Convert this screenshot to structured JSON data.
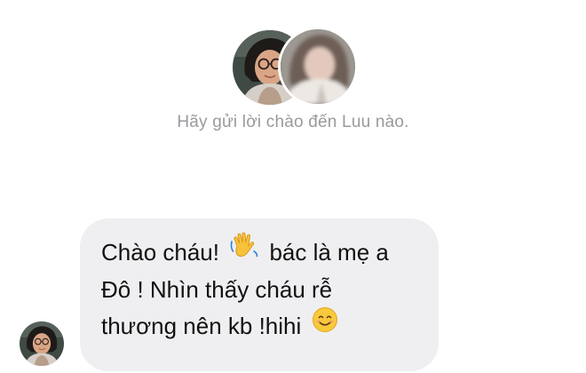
{
  "header": {
    "avatars": [
      {
        "icon": "profile-photo-woman-glasses"
      },
      {
        "icon": "profile-photo-blurred-user"
      }
    ],
    "greeting": "Hãy gửi lời chào đến Luu nào."
  },
  "message": {
    "sender_avatar_icon": "profile-photo-woman-glasses",
    "lines": [
      {
        "before": "Chào cháu! ",
        "emoji": "waving-hand-emoji",
        "after": " bác là mẹ a"
      },
      {
        "text": "Đô ! Nhìn thấy cháu rễ"
      },
      {
        "before": "thương nên kb !hihi ",
        "emoji": "smiling-face-emoji",
        "after": ""
      }
    ],
    "bubble_color": "#efeff1",
    "text_color": "#111111"
  },
  "colors": {
    "background": "#ffffff",
    "greeting_text": "#9a9a9e"
  }
}
